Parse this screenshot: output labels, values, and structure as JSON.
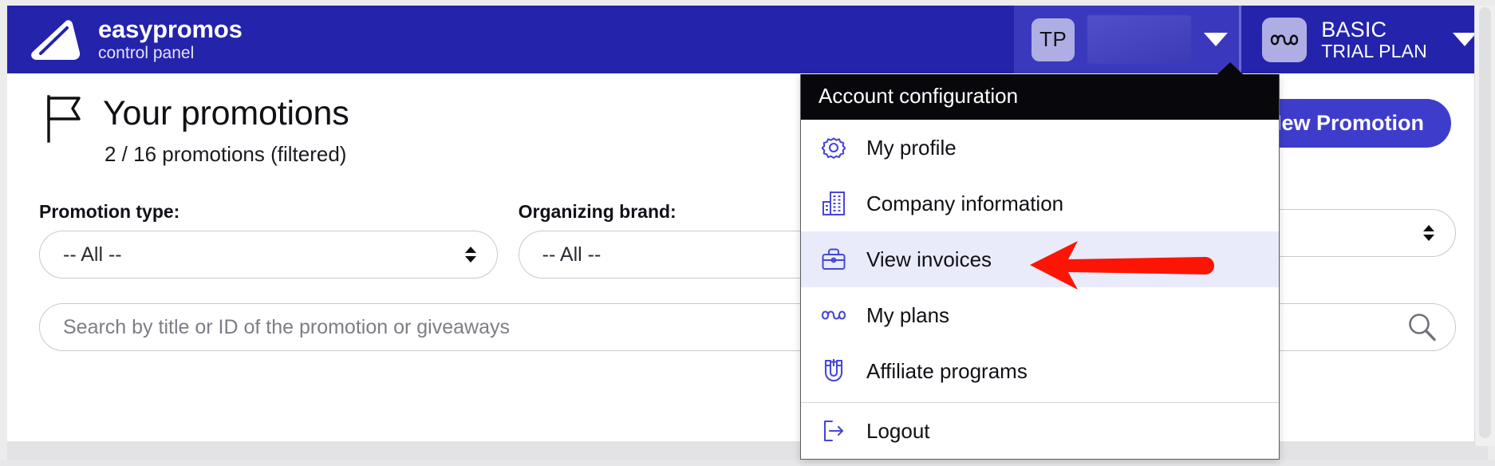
{
  "header": {
    "brand_title": "easypromos",
    "brand_subtitle": "control panel",
    "logo_icon": "easypromos-flag-logo",
    "user": {
      "avatar_initials": "TP",
      "name_redacted": "",
      "caret_icon": "chevron-down-icon"
    },
    "plan": {
      "icon": "infinity-icon",
      "name": "BASIC",
      "type": "TRIAL PLAN",
      "caret_icon": "chevron-down-icon"
    }
  },
  "main": {
    "title_icon": "flag-icon",
    "title": "Your promotions",
    "subtitle": "2 / 16 promotions (filtered)",
    "new_promotion_button": "New Promotion",
    "filters": [
      {
        "label": "Promotion type:",
        "value": "-- All --"
      },
      {
        "label": "Organizing brand:",
        "value": "-- All --"
      },
      {
        "label": "",
        "value": ""
      }
    ],
    "search": {
      "placeholder": "Search by title or ID of the promotion or giveaways",
      "value": "",
      "icon": "search-icon"
    }
  },
  "dropdown": {
    "header": "Account configuration",
    "items": [
      {
        "label": "My profile",
        "icon": "gear-icon",
        "active": false
      },
      {
        "label": "Company information",
        "icon": "building-icon",
        "active": false
      },
      {
        "label": "View invoices",
        "icon": "invoice-briefcase-icon",
        "active": true
      },
      {
        "label": "My plans",
        "icon": "infinity-icon",
        "active": false
      },
      {
        "label": "Affiliate programs",
        "icon": "magnet-icon",
        "active": false
      },
      {
        "label": "Logout",
        "icon": "logout-icon",
        "active": false
      }
    ]
  },
  "annotation": {
    "arrow_icon": "red-arrow-pointing-left",
    "arrow_color": "#fc1405",
    "points_at": "View invoices"
  },
  "colors": {
    "brand_blue": "#2423ab",
    "accent_button": "#3e3dcb",
    "menu_header_black": "#08080c",
    "active_row": "#e9ebfa",
    "icon_blue": "#4746d8"
  }
}
